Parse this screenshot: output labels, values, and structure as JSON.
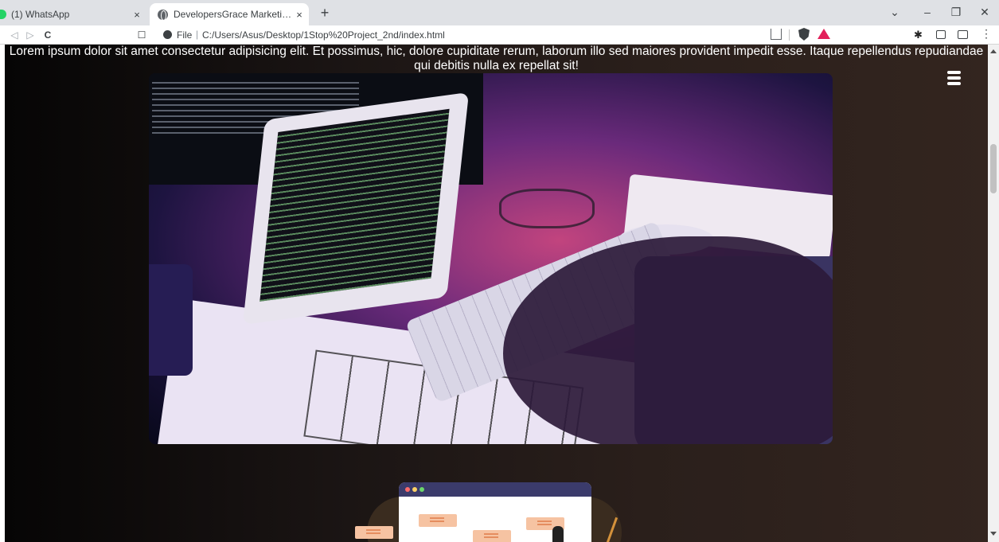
{
  "browser": {
    "tabs": [
      {
        "title": "(1) WhatsApp",
        "icon": "whatsapp-icon",
        "close": "×"
      },
      {
        "title": "DevelopersGrace Marketing and",
        "icon": "globe-icon",
        "close": "×"
      }
    ],
    "new_tab": "+",
    "window_controls": {
      "dropdown": "⌄",
      "minimize": "–",
      "restore": "❐",
      "close": "✕"
    },
    "nav": {
      "back": "◁",
      "forward": "▷",
      "reload": "C",
      "bookmark": "☐"
    },
    "address": {
      "scheme_label": "File",
      "separator": "|",
      "url": "C:/Users/Asus/Desktop/1Stop%20Project_2nd/index.html"
    },
    "extensions": {
      "puzzle": "✱",
      "menu": "⋮"
    },
    "accent_colors": {
      "brave": "#3c4043",
      "bat": "#e2205a",
      "whatsapp": "#25d366"
    }
  },
  "page": {
    "intro_text": "Lorem ipsum dolor sit amet consectetur adipisicing elit. Et possimus, hic, dolore cupiditate rerum, laborum illo sed maiores provident impedit esse. Itaque repellendus repudiandae qui debitis nulla ex repellat sit!",
    "menu_icon": "hamburger-menu-icon",
    "hero_image": "laptop-coding-desk-photo",
    "illustration": "web-window-illustration"
  }
}
